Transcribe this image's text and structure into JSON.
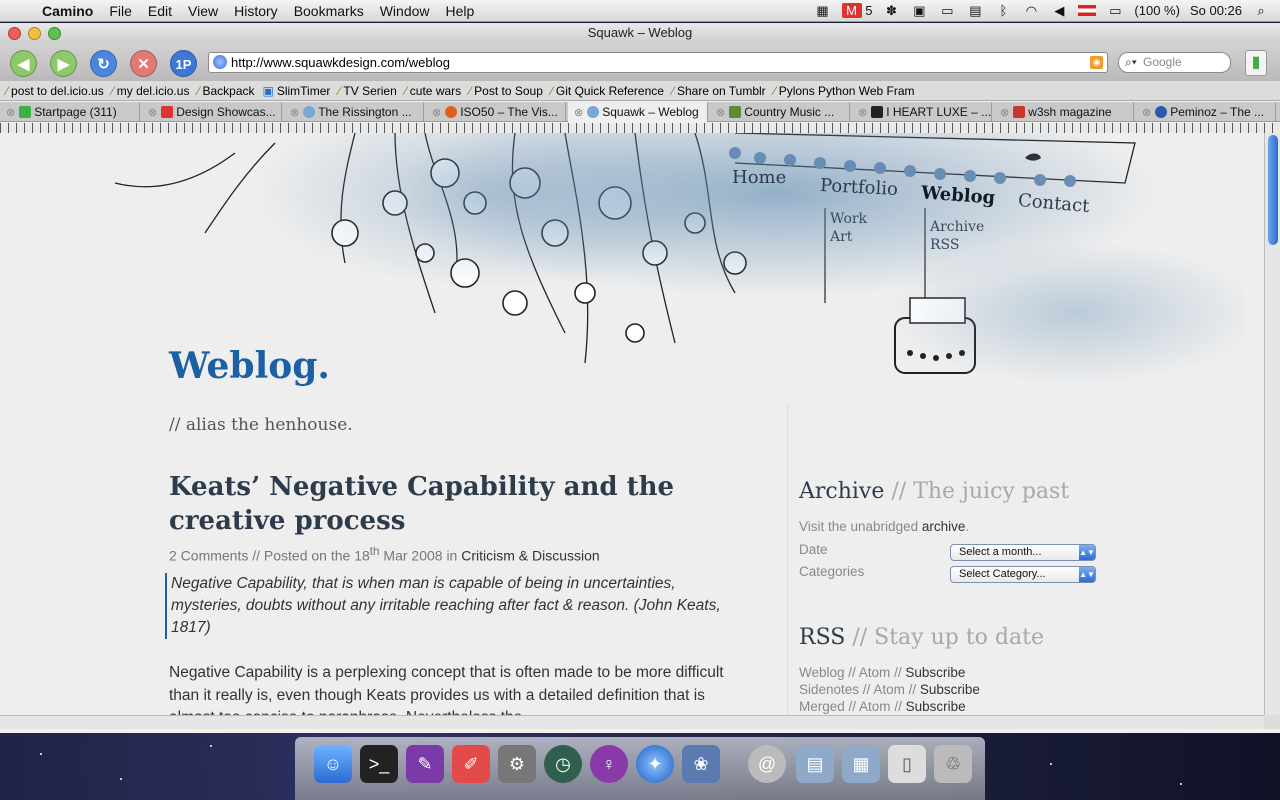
{
  "menubar": {
    "apple_icon": "apple-logo",
    "app_name": "Camino",
    "menus": [
      "File",
      "Edit",
      "View",
      "History",
      "Bookmarks",
      "Window",
      "Help"
    ],
    "mail_count": "5",
    "battery_text": "(100 %)",
    "clock": "So 00:26"
  },
  "window": {
    "title": "Squawk – Weblog",
    "url": "http://www.squawkdesign.com/weblog",
    "search_placeholder": "Google",
    "onepassword_label": "1P"
  },
  "bookmarks": [
    "post to del.icio.us",
    "my del.icio.us",
    "Backpack",
    "SlimTimer",
    "TV Serien",
    "cute wars",
    "Post to Soup",
    "Git Quick Reference",
    "Share on Tumblr",
    "Pylons Python Web Fram"
  ],
  "tabs": [
    "Startpage (311)",
    "Design Showcas...",
    "The Rissington ...",
    "ISO50 – The Vis...",
    "Squawk – Weblog",
    "Country Music ...",
    "I HEART LUXE – ...",
    "w3sh magazine",
    "Peminoz – The ..."
  ],
  "site": {
    "nav": {
      "home": "Home",
      "portfolio": "Portfolio",
      "weblog": "Weblog",
      "contact": "Contact",
      "work": "Work",
      "art": "Art",
      "archive": "Archive",
      "rss": "RSS"
    },
    "title": "Weblog.",
    "subtitle": "// alias the henhouse.",
    "post": {
      "title": "Keats’ Negative Capability and the creative process",
      "comments": "2 Comments",
      "posted_prefix": " // Posted on the 18",
      "posted_sup": "th",
      "posted_suffix": " Mar 2008 in ",
      "category": "Criticism & Discussion",
      "quote": "Negative Capability, that is when man is capable of being in uncertainties, mysteries, doubts without any irritable reaching after fact & reason. (John Keats, 1817)",
      "body": "Negative Capability is a perplexing concept that is often made to be more difficult than it really is, even though Keats provides us with a detailed definition that is almost too concise to paraphrase. Nevertheless the"
    },
    "archive": {
      "heading": "Archive",
      "heading_dim": " // The juicy past",
      "visit_prefix": "Visit the unabridged ",
      "visit_link": "archive",
      "visit_suffix": ".",
      "date_label": "Date",
      "categories_label": "Categories",
      "date_select": "Select a month...",
      "category_select": "Select Category..."
    },
    "rss": {
      "heading": "RSS",
      "heading_dim": " // Stay up to date",
      "rows": [
        {
          "name": "Weblog",
          "sep1": " // ",
          "atom": "Atom",
          "sep2": " // ",
          "sub": "Subscribe"
        },
        {
          "name": "Sidenotes",
          "sep1": " // ",
          "atom": "Atom",
          "sep2": " // ",
          "sub": "Subscribe"
        },
        {
          "name": "Merged",
          "sep1": " // ",
          "atom": "Atom",
          "sep2": " // ",
          "sub": "Subscribe"
        }
      ]
    }
  },
  "colors": {
    "accent_blue": "#1c5fa3",
    "heading": "#2d3b4b",
    "muted": "#888888",
    "wash_blue": "#5d8ab2"
  },
  "dock": [
    "finder-icon",
    "terminal-icon",
    "coda-icon",
    "css-edit-icon",
    "system-preferences-icon",
    "time-machine-icon",
    "adium-icon",
    "safari-icon",
    "iphoto-icon",
    "mail-icon",
    "folder-icon",
    "movies-folder-icon",
    "documents-icon",
    "trash-icon"
  ]
}
